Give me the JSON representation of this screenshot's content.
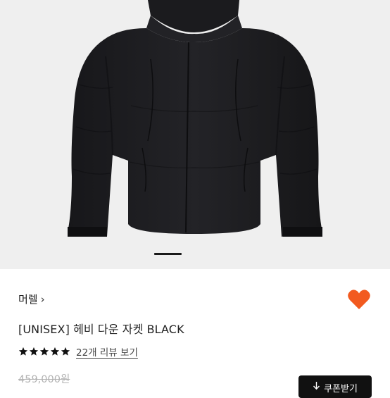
{
  "product": {
    "brand": "머렐",
    "brand_chevron": "›",
    "title": "[UNISEX] 헤비 다운 자켓 BLACK",
    "rating_stars": 5,
    "review_link": "22개 리뷰 보기",
    "original_price": "459,000원",
    "coupon_button": "쿠폰받기",
    "coupon_icon": "download-arrow-icon"
  },
  "gallery": {
    "image_alt": "black down jacket photo",
    "active_page": 1
  },
  "colors": {
    "heart": "#f25a1f",
    "background_photo": "#efefef",
    "jacket": "#1c1c1f",
    "coupon_bg": "#111111"
  }
}
